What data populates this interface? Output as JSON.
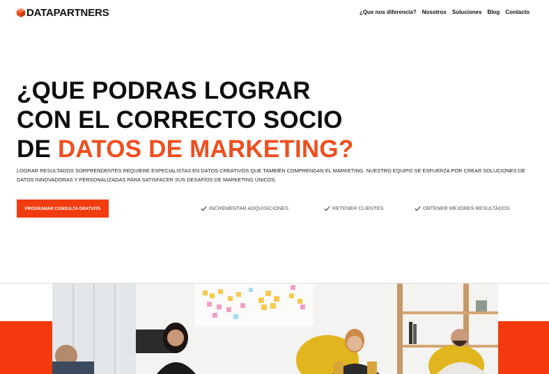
{
  "header": {
    "logo_text": "DATAPARTNERS",
    "nav": [
      "¿Que nos diferencia?",
      "Nosotros",
      "Soluciones",
      "Blog",
      "Contacto"
    ]
  },
  "hero": {
    "title_line1": "¿QUE PODRAS LOGRAR",
    "title_line2": "CON EL CORRECTO SOCIO",
    "title_line3_prefix": "DE ",
    "title_line3_accent": "DATOS DE MARKETING?",
    "description": "LOGRAR RESULTADOS SORPRENDENTES REQUIERE ESPECIALISTAS EN DATOS CREATIVOS QUE TAMBIÉN COMPRENDAN EL MARKETING. NUESTRO EQUIPO SE ESFUERZA POR CREAR SOLUCIONES DE DATOS INNOVADORAS Y PERSONALIZADAS PARA SATISFACER SUS DESAFÍOS DE MARKETING ÚNICOS.",
    "cta_label": "PROGRAMAR CONSULTA GRATUITA",
    "benefits": [
      "INCREMENTAR ADQUISICIONES",
      "RETENER CLIENTES",
      "OBTENER MEJORES RESULTADOS"
    ]
  },
  "colors": {
    "accent": "#f04e1f",
    "cta_bg": "#f03c0f",
    "block": "#f43a0c"
  },
  "icons": {
    "logo": "hexagon-logo-icon",
    "benefit": "check-icon"
  }
}
